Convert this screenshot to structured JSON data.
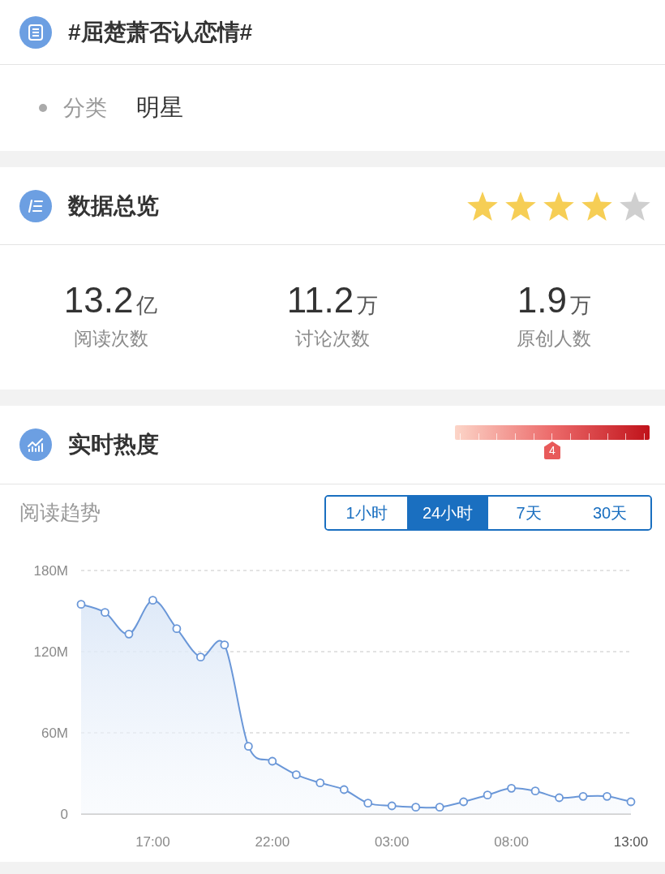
{
  "topic": {
    "title": "#屈楚萧否认恋情#",
    "category_label": "分类",
    "category_value": "明星"
  },
  "overview": {
    "title": "数据总览",
    "stars": 4,
    "stats": [
      {
        "value": "13.2",
        "unit": "亿",
        "label": "阅读次数"
      },
      {
        "value": "11.2",
        "unit": "万",
        "label": "讨论次数"
      },
      {
        "value": "1.9",
        "unit": "万",
        "label": "原创人数"
      }
    ]
  },
  "realtime": {
    "title": "实时热度",
    "heat": {
      "level": 0.5,
      "value": "4"
    },
    "trend_label": "阅读趋势",
    "tabs": [
      {
        "label": "1小时",
        "selected": false
      },
      {
        "label": "24小时",
        "selected": true
      },
      {
        "label": "7天",
        "selected": false
      },
      {
        "label": "30天",
        "selected": false
      }
    ],
    "chart_data": {
      "type": "area",
      "categories": [
        null,
        null,
        null,
        "17:00",
        null,
        null,
        null,
        null,
        "22:00",
        null,
        null,
        null,
        null,
        "03:00",
        null,
        null,
        null,
        null,
        "08:00",
        null,
        null,
        null,
        null,
        "13:00"
      ],
      "series": [
        {
          "color": "#6a97d8",
          "values": [
            155,
            149,
            133,
            158,
            137,
            116,
            125,
            50,
            39,
            29,
            23,
            18,
            8,
            6,
            5,
            5,
            9,
            14,
            19,
            17,
            12,
            13,
            13,
            9
          ]
        }
      ],
      "ylim": [
        0,
        180
      ],
      "yticks": [
        {
          "value": 0,
          "label": "0"
        },
        {
          "value": 60,
          "label": "60M"
        },
        {
          "value": 120,
          "label": "120M"
        },
        {
          "value": 180,
          "label": "180M"
        }
      ]
    }
  }
}
